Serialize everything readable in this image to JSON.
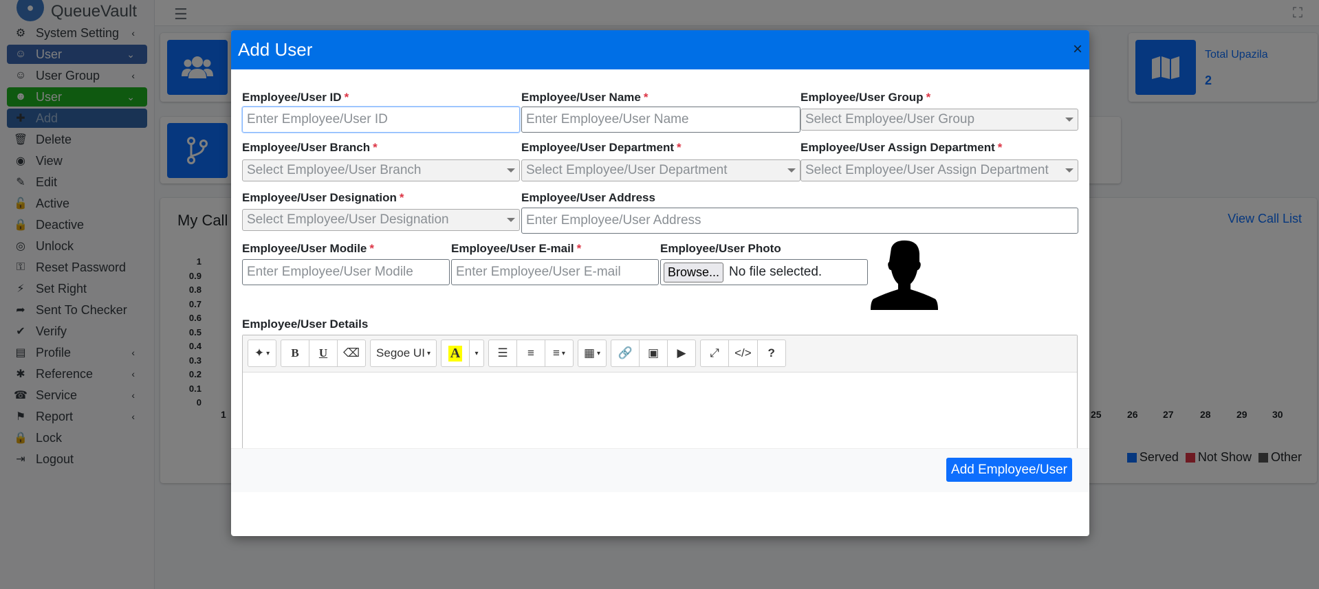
{
  "app": {
    "brand": "QueueVault"
  },
  "sidebar": {
    "items": [
      {
        "label": "System Setting",
        "icon": "gear-icon",
        "arrow": "‹",
        "state": ""
      },
      {
        "label": "User",
        "icon": "users-icon",
        "arrow": "⌄",
        "state": "blue"
      },
      {
        "label": "User Group",
        "icon": "users-icon",
        "arrow": "‹",
        "state": ""
      },
      {
        "label": "User",
        "icon": "user-icon",
        "arrow": "⌄",
        "state": "green"
      },
      {
        "label": "Add",
        "icon": "user-plus-icon",
        "arrow": "",
        "state": "dark"
      },
      {
        "label": "Delete",
        "icon": "trash-icon",
        "arrow": "",
        "state": ""
      },
      {
        "label": "View",
        "icon": "eye-icon",
        "arrow": "",
        "state": ""
      },
      {
        "label": "Edit",
        "icon": "pen-icon",
        "arrow": "",
        "state": ""
      },
      {
        "label": "Active",
        "icon": "unlock-icon",
        "arrow": "",
        "state": ""
      },
      {
        "label": "Deactive",
        "icon": "lock-icon",
        "arrow": "",
        "state": ""
      },
      {
        "label": "Unlock",
        "icon": "fingerprint-icon",
        "arrow": "",
        "state": ""
      },
      {
        "label": "Reset Password",
        "icon": "key-icon",
        "arrow": "",
        "state": ""
      },
      {
        "label": "Set Right",
        "icon": "bolt-icon",
        "arrow": "",
        "state": ""
      },
      {
        "label": "Sent To Checker",
        "icon": "share-icon",
        "arrow": "",
        "state": ""
      },
      {
        "label": "Verify",
        "icon": "check-icon",
        "arrow": "",
        "state": ""
      },
      {
        "label": "Profile",
        "icon": "id-card-icon",
        "arrow": "‹",
        "state": ""
      },
      {
        "label": "Reference",
        "icon": "asterisk-icon",
        "arrow": "‹",
        "state": ""
      },
      {
        "label": "Service",
        "icon": "headset-icon",
        "arrow": "‹",
        "state": ""
      },
      {
        "label": "Report",
        "icon": "flag-icon",
        "arrow": "‹",
        "state": ""
      },
      {
        "label": "Lock",
        "icon": "lock-icon",
        "arrow": "",
        "state": ""
      },
      {
        "label": "Logout",
        "icon": "logout-icon",
        "arrow": "",
        "state": ""
      }
    ]
  },
  "dashboard": {
    "total_upazila_label": "Total Upazila",
    "total_upazila_value": "2",
    "chart_title": "My Call",
    "view_call_list": "View Call List"
  },
  "chart_data": {
    "type": "bar",
    "title": "My Call",
    "y_ticks": [
      "1",
      "0.9",
      "0.8",
      "0.7",
      "0.6",
      "0.5",
      "0.4",
      "0.3",
      "0.2",
      "0.1",
      "0"
    ],
    "x_ticks_visible": [
      "1",
      "25",
      "26",
      "27",
      "28",
      "29",
      "30"
    ],
    "ylim": [
      0,
      1
    ],
    "series": [
      {
        "name": "Served",
        "color": "#0d6efd"
      },
      {
        "name": "Not Show",
        "color": "#dc3545"
      },
      {
        "name": "Other",
        "color": "#555555"
      }
    ],
    "legend": "bottom-right"
  },
  "modal": {
    "title": "Add User",
    "close": "×",
    "fields": {
      "user_id": {
        "label": "Employee/User ID",
        "required": "*",
        "placeholder": "Enter Employee/User ID"
      },
      "user_name": {
        "label": "Employee/User Name",
        "required": "*",
        "placeholder": "Enter Employee/User Name"
      },
      "user_group": {
        "label": "Employee/User Group",
        "required": "*",
        "placeholder": "Select Employee/User Group"
      },
      "branch": {
        "label": "Employee/User Branch",
        "required": "*",
        "placeholder": "Select Employee/User Branch"
      },
      "department": {
        "label": "Employee/User Department",
        "required": "*",
        "placeholder": "Select Employee/User Department"
      },
      "assign_department": {
        "label": "Employee/User Assign Department",
        "required": "*",
        "placeholder": "Select Employee/User Assign Department"
      },
      "designation": {
        "label": "Employee/User Designation",
        "required": "*",
        "placeholder": "Select Employee/User Designation"
      },
      "address": {
        "label": "Employee/User Address",
        "placeholder": "Enter Employee/User Address"
      },
      "mobile": {
        "label": "Employee/User Modile",
        "required": "*",
        "placeholder": "Enter Employee/User Modile"
      },
      "email": {
        "label": "Employee/User E-mail",
        "required": "*",
        "placeholder": "Enter Employee/User E-mail"
      },
      "photo": {
        "label": "Employee/User Photo",
        "browse": "Browse...",
        "status": "No file selected."
      },
      "details": {
        "label": "Employee/User Details"
      }
    },
    "editor": {
      "font": "Segoe UI",
      "help": "?",
      "code": "</>",
      "bold": "B",
      "underline": "U",
      "color_a": "A"
    },
    "submit": "Add Employee/User"
  }
}
